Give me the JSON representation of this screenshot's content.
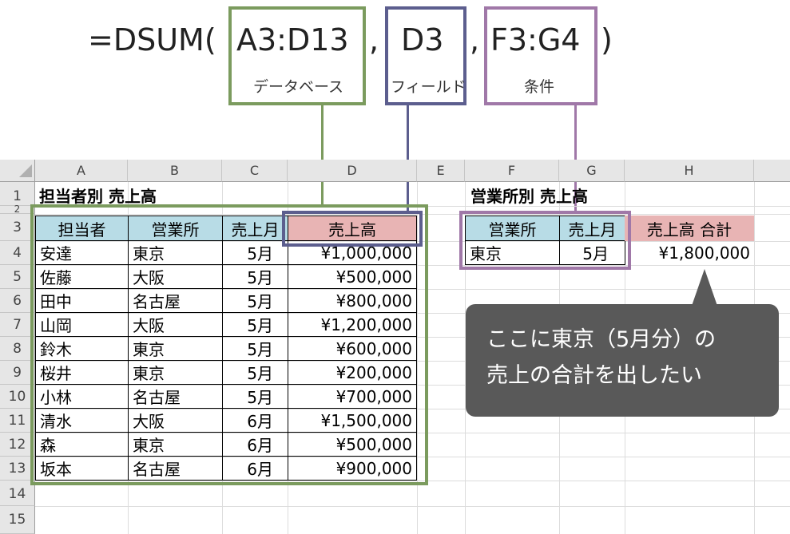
{
  "formula": {
    "prefix": "=DSUM(",
    "arg1": "A3:D13",
    "sep1": ",",
    "arg2": "D3",
    "sep2": ",",
    "arg3": "F3:G4",
    "suffix": ")",
    "captions": {
      "database": "データベース",
      "field": "フィールド",
      "criteria": "条件"
    },
    "colors": {
      "database": "#7b9b5e",
      "field": "#5c5e8e",
      "criteria": "#a078a8"
    }
  },
  "sheet": {
    "columns": [
      "A",
      "B",
      "C",
      "D",
      "E",
      "F",
      "G",
      "H"
    ],
    "rows": [
      "1",
      "2",
      "3",
      "4",
      "5",
      "6",
      "7",
      "8",
      "9",
      "10",
      "11",
      "12",
      "13",
      "14",
      "15"
    ],
    "title_left": "担当者別 売上高",
    "title_right": "営業所別 売上高",
    "table_headers": [
      "担当者",
      "営業所",
      "売上月",
      "売上高"
    ],
    "table_rows": [
      [
        "安達",
        "東京",
        "5月",
        "¥1,000,000"
      ],
      [
        "佐藤",
        "大阪",
        "5月",
        "¥500,000"
      ],
      [
        "田中",
        "名古屋",
        "5月",
        "¥800,000"
      ],
      [
        "山岡",
        "大阪",
        "5月",
        "¥1,200,000"
      ],
      [
        "鈴木",
        "東京",
        "5月",
        "¥600,000"
      ],
      [
        "桜井",
        "東京",
        "5月",
        "¥200,000"
      ],
      [
        "小林",
        "名古屋",
        "5月",
        "¥700,000"
      ],
      [
        "清水",
        "大阪",
        "6月",
        "¥1,500,000"
      ],
      [
        "森",
        "東京",
        "6月",
        "¥500,000"
      ],
      [
        "坂本",
        "名古屋",
        "6月",
        "¥900,000"
      ]
    ],
    "criteria_headers": [
      "営業所",
      "売上月"
    ],
    "criteria_values": [
      "東京",
      "5月"
    ],
    "result_header": "売上高 合計",
    "result_value": "¥1,800,000"
  },
  "callout": {
    "line1": "ここに東京（5月分）の",
    "line2": "売上の合計を出したい"
  }
}
